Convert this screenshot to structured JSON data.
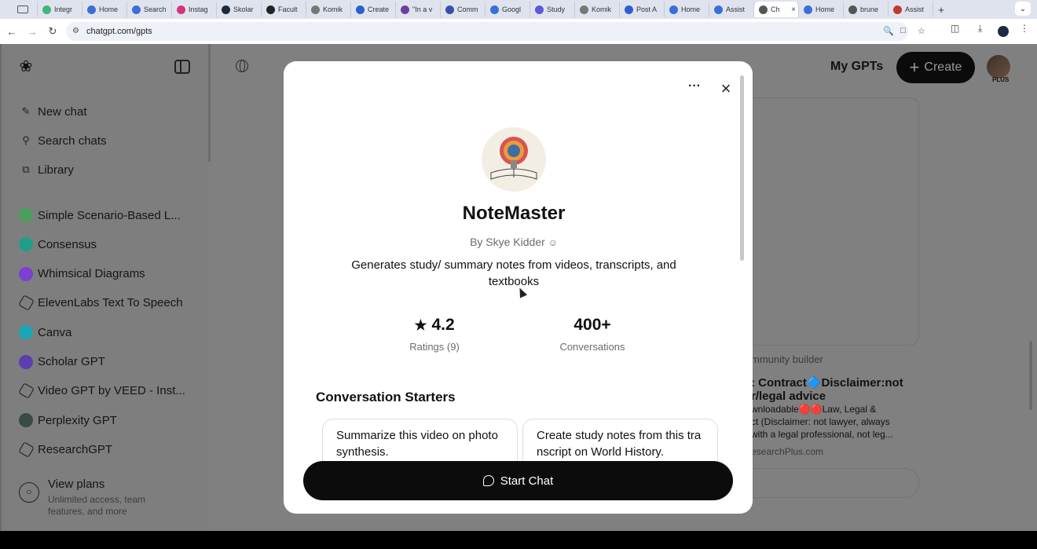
{
  "browser": {
    "tabs": [
      {
        "label": "Integr",
        "color": "#3fb67a"
      },
      {
        "label": "Home",
        "color": "#3b6fd6"
      },
      {
        "label": "Search",
        "color": "#3b6fd6"
      },
      {
        "label": "Instag",
        "color": "#d6337f"
      },
      {
        "label": "Skolar",
        "color": "#1e2a3a"
      },
      {
        "label": "Facult",
        "color": "#222222"
      },
      {
        "label": "Komik",
        "color": "#777777"
      },
      {
        "label": "Create",
        "color": "#2a62c9"
      },
      {
        "label": "\"In a v",
        "color": "#6b3fa0"
      },
      {
        "label": "Comm",
        "color": "#3b4fa8"
      },
      {
        "label": "Googl",
        "color": "#3a6fd8"
      },
      {
        "label": "Study",
        "color": "#5a5ad6"
      },
      {
        "label": "Komik",
        "color": "#777777"
      },
      {
        "label": "Post A",
        "color": "#2d5fd0"
      },
      {
        "label": "Home",
        "color": "#3b6fd6"
      },
      {
        "label": "Assist",
        "color": "#3b6fd6"
      },
      {
        "label": "Ch",
        "color": "#555555",
        "active": true
      },
      {
        "label": "Home",
        "color": "#3b6fd6"
      },
      {
        "label": "brune",
        "color": "#555555"
      },
      {
        "label": "Assist",
        "color": "#c0392b"
      }
    ],
    "url": "chatgpt.com/gpts"
  },
  "sidebar": {
    "new_chat": "New chat",
    "search_chats": "Search chats",
    "library": "Library",
    "gpts": [
      {
        "label": "Simple Scenario-Based L...",
        "color": "#4aa05a"
      },
      {
        "label": "Consensus",
        "color": "#1f9e8a"
      },
      {
        "label": "Whimsical Diagrams",
        "color": "#7b3fd1"
      },
      {
        "label": "ElevenLabs Text To Speech",
        "color": ""
      },
      {
        "label": "Canva",
        "color": "#1aa6b7"
      },
      {
        "label": "Scholar GPT",
        "color": "#5b3fb0"
      },
      {
        "label": "Video GPT by VEED - Inst...",
        "color": ""
      },
      {
        "label": "Perplexity GPT",
        "color": "#3a4a44"
      },
      {
        "label": "ResearchGPT",
        "color": ""
      }
    ],
    "view_plans": {
      "title": "View plans",
      "subtitle": "Unlimited access, team features, and more"
    }
  },
  "header": {
    "my_gpts": "My GPTs",
    "create": "Create",
    "plan_badge": "PLUS"
  },
  "background": {
    "builder": "mmunity builder",
    "card_title_1": ": Contract🔷Disclaimer:not",
    "card_title_2": "r/legal advice",
    "card_desc_1": "wnloadable🔴🔴Law, Legal &",
    "card_desc_2": "ct (Disclaimer: not lawyer, always",
    "card_desc_3": "with a legal professional, not leg...",
    "card_author": "esearchPlus.com"
  },
  "modal": {
    "name": "NoteMaster",
    "author": "By Skye Kidder",
    "description": "Generates study/ summary notes from videos, transcripts, and textbooks",
    "rating": "4.2",
    "rating_label": "Ratings (9)",
    "conversations": "400+",
    "conversations_label": "Conversations",
    "starters_title": "Conversation Starters",
    "starters": [
      "Summarize this video on photo synthesis.",
      "Create study notes from this tra nscript on World History."
    ],
    "start_chat": "Start Chat"
  }
}
